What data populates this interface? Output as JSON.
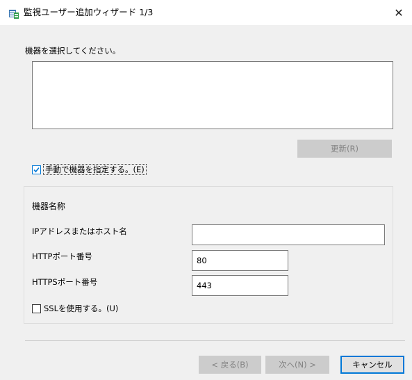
{
  "window": {
    "title": "監視ユーザー追加ウィザード 1/3",
    "close_glyph": "✕"
  },
  "device_select": {
    "instruction": "機器を選択してください。",
    "refresh_label": "更新(R)"
  },
  "manual": {
    "checkbox_label": "手動で機器を指定する。(E)",
    "checked": true
  },
  "device_name_group": {
    "title": "機器名称",
    "ip_label": "IPアドレスまたはホスト名",
    "ip_value": "",
    "http_port_label": "HTTPポート番号",
    "http_port_value": "80",
    "https_port_label": "HTTPSポート番号",
    "https_port_value": "443",
    "ssl_label": "SSLを使用する。(U)",
    "ssl_checked": false
  },
  "footer": {
    "back_label": "< 戻る(B)",
    "next_label": "次へ(N) >",
    "cancel_label": "キャンセル"
  },
  "colors": {
    "accent": "#0078d7",
    "dialog_bg": "#f0f0f0",
    "disabled_button": "#cccccc"
  },
  "icons": {
    "title_icon": "monitor-app-icon",
    "check_icon": "checkmark-icon"
  }
}
